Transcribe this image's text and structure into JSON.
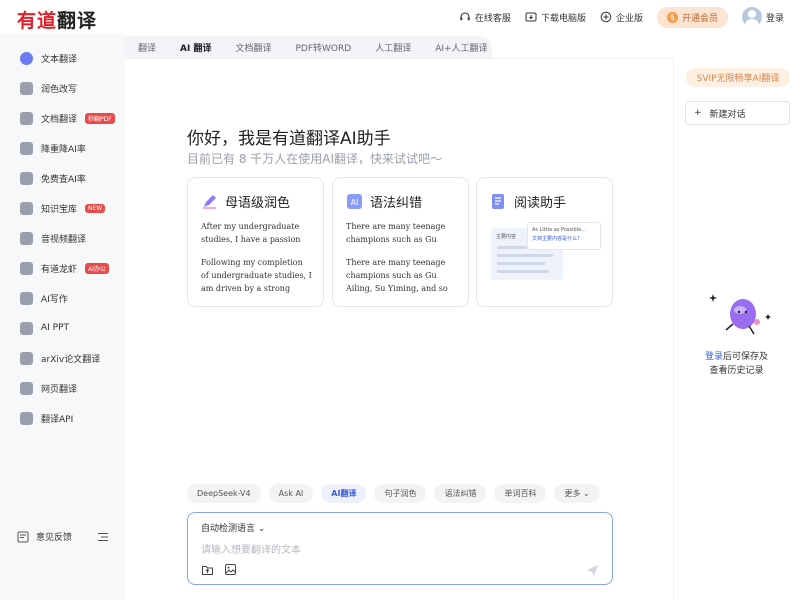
{
  "header": {
    "logo_red": "有道",
    "logo_dark": "翻译",
    "support": "在线客服",
    "download": "下载电脑版",
    "enterprise": "企业版",
    "vip": "开通会员",
    "login": "登录"
  },
  "sidebar": {
    "items": [
      {
        "label": "文本翻译",
        "tag": ""
      },
      {
        "label": "润色改写",
        "tag": ""
      },
      {
        "label": "文档翻译",
        "tag": "秒翻PDF"
      },
      {
        "label": "降重降AI率",
        "tag": ""
      },
      {
        "label": "免费查AI率",
        "tag": ""
      },
      {
        "label": "知识宝库",
        "tag": "NEW"
      },
      {
        "label": "音视频翻译",
        "tag": ""
      },
      {
        "label": "有道龙虾",
        "tag": "AI办公"
      },
      {
        "label": "AI写作",
        "tag": ""
      },
      {
        "label": "AI PPT",
        "tag": ""
      },
      {
        "label": "arXiv论文翻译",
        "tag": ""
      },
      {
        "label": "网页翻译",
        "tag": ""
      },
      {
        "label": "翻译API",
        "tag": ""
      }
    ],
    "feedback": "意见反馈"
  },
  "tabs": [
    "翻译",
    "AI 翻译",
    "文档翻译",
    "PDF转WORD",
    "人工翻译",
    "AI+人工翻译"
  ],
  "greeting": {
    "title": "你好，我是有道翻译AI助手",
    "subtitle": "目前已有 8 千万人在使用AI翻译，快来试试吧～"
  },
  "cards": [
    {
      "title": "母语级润色",
      "text1": "After my undergraduate studies, I have a passion for…",
      "text2": "Following my completion of undergraduate studies, I am driven by a strong passion to…"
    },
    {
      "title": "语法纠错",
      "text1": "There are many teenage champions such as Gu Ailin…",
      "text2": "There are many teenage champions such as Gu Ailing, Su Yiming, and so on who…"
    },
    {
      "title": "阅读助手",
      "mini_line1": "As Little as Possible...",
      "mini_line2": "文档主要内容是什么?",
      "mini_doc_label": "主要内容"
    }
  ],
  "chips": [
    "DeepSeek-V4",
    "Ask AI",
    "AI翻译",
    "句子润色",
    "语法纠错",
    "单词百科",
    "更多"
  ],
  "input": {
    "lang": "自动检测语言",
    "placeholder": "请输入想要翻译的文本"
  },
  "right_panel": {
    "svip": "SVIP无限畅享AI翻译",
    "new_chat": "新建对话",
    "login_link": "登录",
    "login_text1": "后可保存及",
    "login_text2": "查看历史记录"
  }
}
